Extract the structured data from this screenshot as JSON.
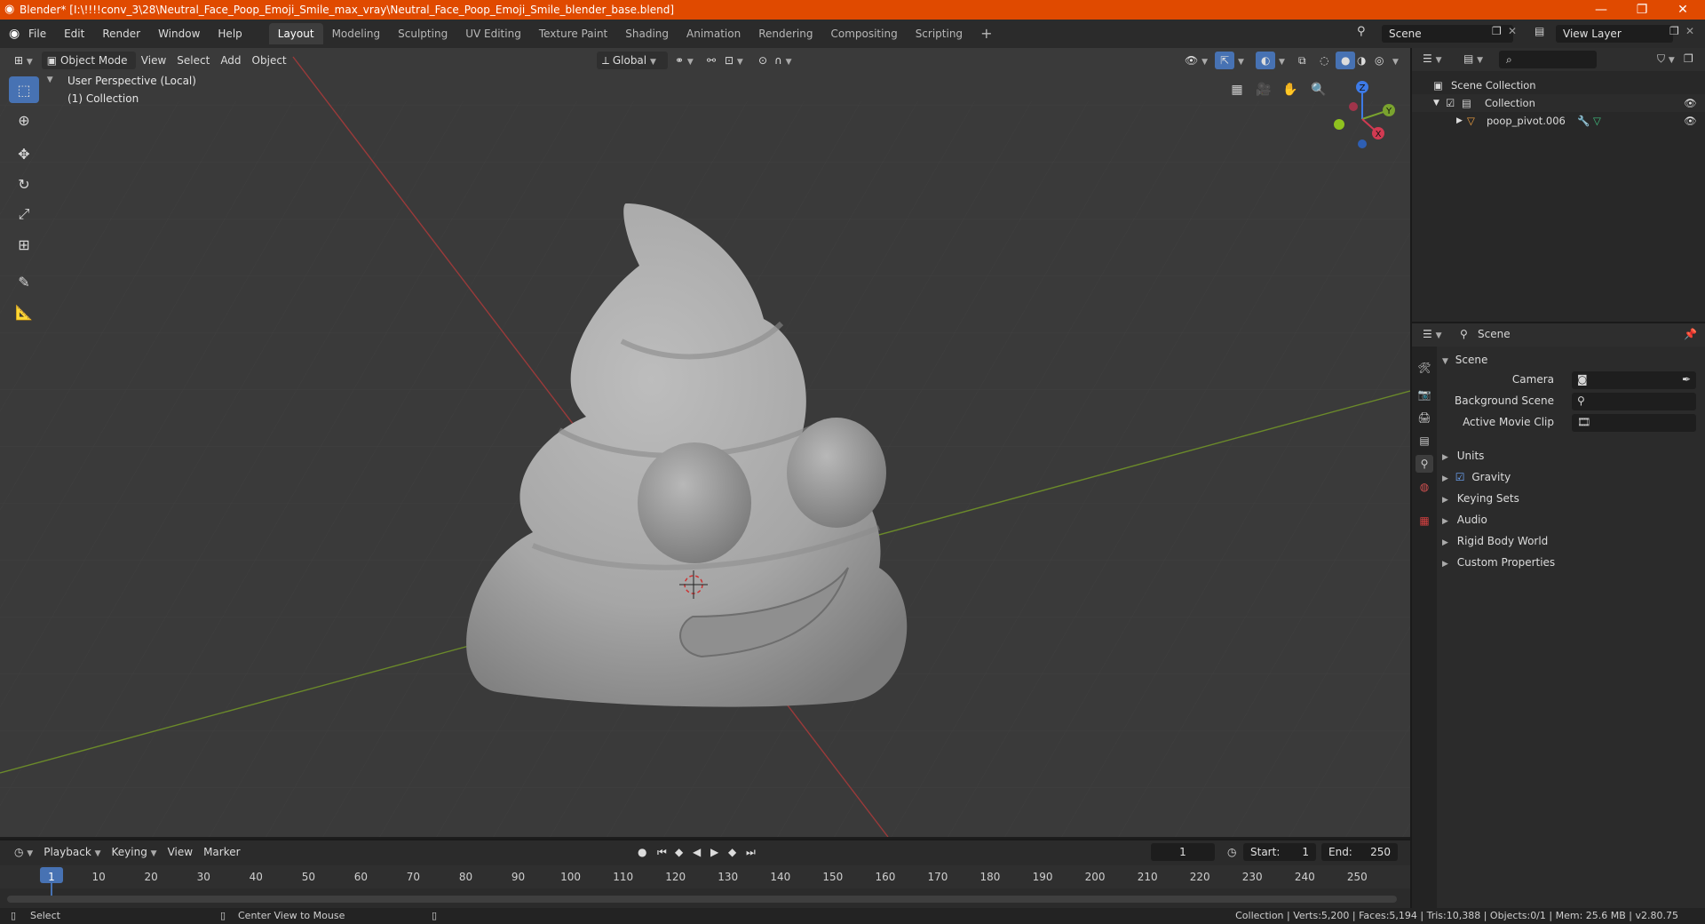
{
  "window": {
    "title": "Blender* [I:\\!!!!conv_3\\28\\Neutral_Face_Poop_Emoji_Smile_max_vray\\Neutral_Face_Poop_Emoji_Smile_blender_base.blend]",
    "accent": "#e04a00"
  },
  "menu": {
    "items": [
      "File",
      "Edit",
      "Render",
      "Window",
      "Help"
    ]
  },
  "workspaces": [
    "Layout",
    "Modeling",
    "Sculpting",
    "UV Editing",
    "Texture Paint",
    "Shading",
    "Animation",
    "Rendering",
    "Compositing",
    "Scripting"
  ],
  "active_workspace": "Layout",
  "scene_selector": {
    "value": "Scene"
  },
  "viewlayer_selector": {
    "value": "View Layer"
  },
  "viewport": {
    "mode": "Object Mode",
    "menus": [
      "View",
      "Select",
      "Add",
      "Object"
    ],
    "transform_orientation": "Global",
    "info_line1": "User Perspective (Local)",
    "info_line2": "(1) Collection",
    "gizmo": {
      "x": "X",
      "y": "Y",
      "z": "Z"
    }
  },
  "outliner": {
    "root": "Scene Collection",
    "collection": "Collection",
    "object": "poop_pivot.006"
  },
  "properties": {
    "header": "Scene",
    "section": "Scene",
    "camera_label": "Camera",
    "background_label": "Background Scene",
    "movieclip_label": "Active Movie Clip",
    "panels": [
      "Units",
      "Gravity",
      "Keying Sets",
      "Audio",
      "Rigid Body World",
      "Custom Properties"
    ]
  },
  "timeline": {
    "menus": [
      "Playback",
      "Keying",
      "View",
      "Marker"
    ],
    "current_frame": "1",
    "start_label": "Start:",
    "start_value": "1",
    "end_label": "End:",
    "end_value": "250",
    "ticks": [
      "1",
      "10",
      "20",
      "30",
      "40",
      "50",
      "60",
      "70",
      "80",
      "90",
      "100",
      "110",
      "120",
      "130",
      "140",
      "150",
      "160",
      "170",
      "180",
      "190",
      "200",
      "210",
      "220",
      "230",
      "240",
      "250"
    ]
  },
  "statusbar": {
    "left1": "Select",
    "left2": "Center View to Mouse",
    "right": "Collection | Verts:5,200 | Faces:5,194 | Tris:10,388 | Objects:0/1 | Mem: 25.6 MB | v2.80.75"
  }
}
